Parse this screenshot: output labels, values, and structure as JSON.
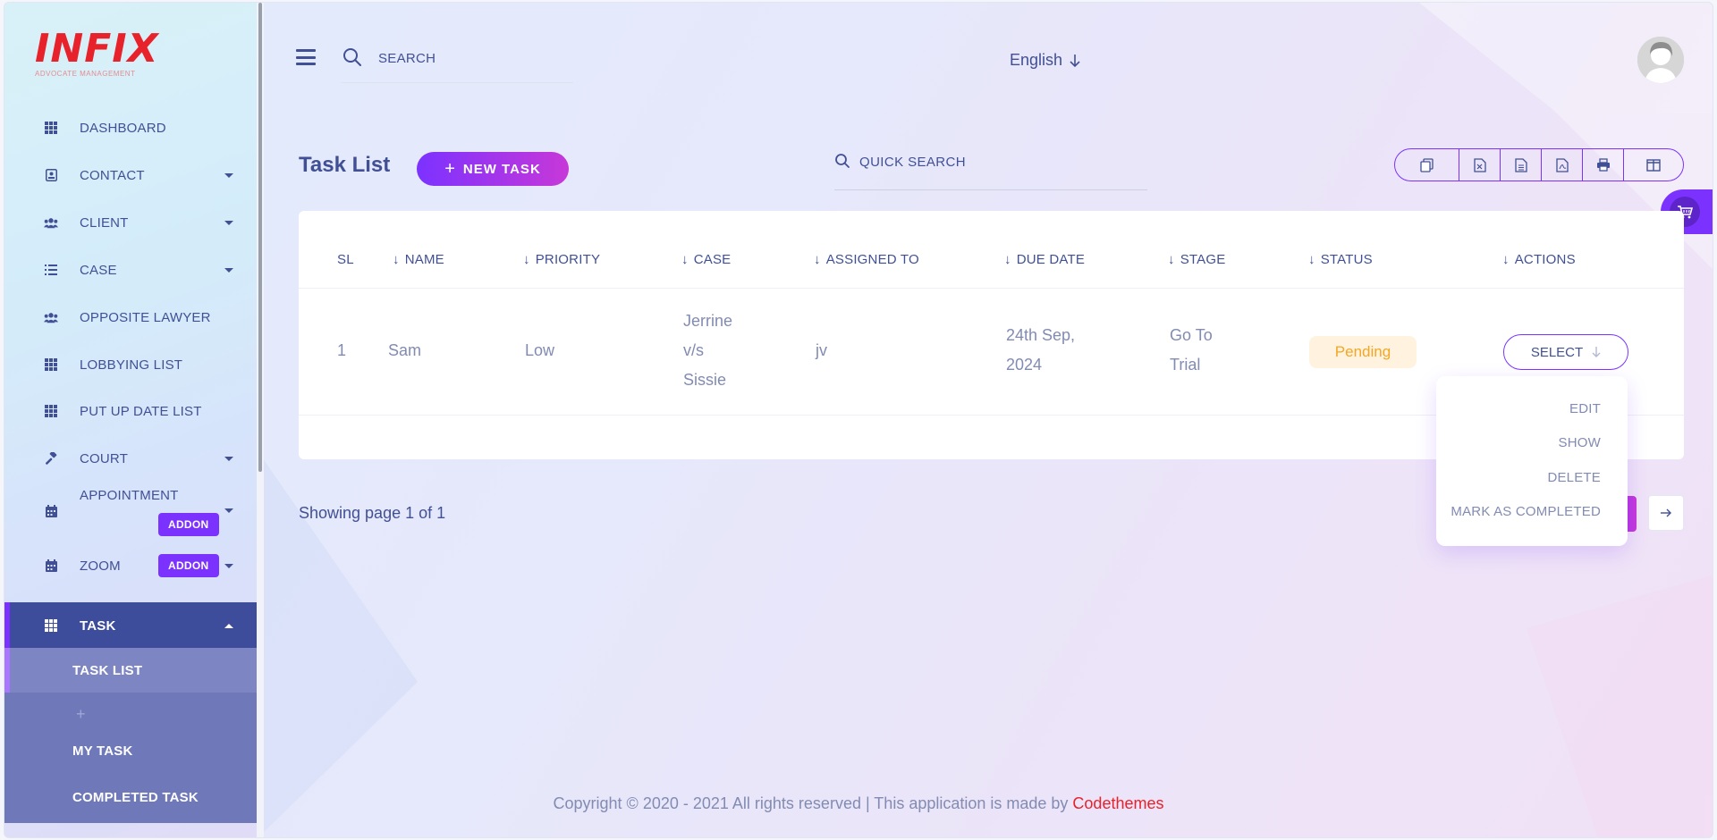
{
  "brand": {
    "logo": "INFIX",
    "tagline": "ADVOCATE MANAGEMENT"
  },
  "header": {
    "search_placeholder": "SEARCH",
    "language": "English"
  },
  "sidebar": {
    "items": [
      {
        "label": "DASHBOARD",
        "icon": "grid-icon"
      },
      {
        "label": "CONTACT",
        "icon": "contact-icon"
      },
      {
        "label": "CLIENT",
        "icon": "users-icon"
      },
      {
        "label": "CASE",
        "icon": "list-icon"
      },
      {
        "label": "OPPOSITE LAWYER",
        "icon": "users-icon"
      },
      {
        "label": "LOBBYING LIST",
        "icon": "grid-icon"
      },
      {
        "label": "PUT UP DATE LIST",
        "icon": "grid-icon"
      },
      {
        "label": "COURT",
        "icon": "gavel-icon"
      },
      {
        "label": "APPOINTMENT",
        "icon": "calendar-icon"
      },
      {
        "label": "ZOOM",
        "icon": "calendar-icon"
      },
      {
        "label": "TASK",
        "icon": "grid-icon"
      }
    ],
    "addon_label": "ADDON",
    "task_sub": [
      "TASK LIST",
      "MY TASK",
      "COMPLETED TASK"
    ]
  },
  "page": {
    "title": "Task List",
    "new_task": "NEW TASK",
    "quick_search": "QUICK SEARCH"
  },
  "table": {
    "columns": [
      "SL",
      "NAME",
      "PRIORITY",
      "CASE",
      "ASSIGNED TO",
      "DUE DATE",
      "STAGE",
      "STATUS",
      "ACTIONS"
    ],
    "rows": [
      {
        "sl": "1",
        "name": "Sam",
        "priority": "Low",
        "case": [
          "Jerrine",
          "v/s",
          "Sissie"
        ],
        "assigned_to": "jv",
        "due_date": [
          "24th Sep,",
          "2024"
        ],
        "stage": [
          "Go To",
          "Trial"
        ],
        "status": "Pending",
        "action": "SELECT"
      }
    ]
  },
  "dropdown": [
    "EDIT",
    "SHOW",
    "DELETE",
    "MARK AS COMPLETED"
  ],
  "pagination": {
    "showing": "Showing page 1 of 1"
  },
  "footer": {
    "text": "Copyright © 2020 - 2021 All rights reserved | This application is made by ",
    "brand": "Codethemes"
  },
  "colors": {
    "accent": "#7c32ff",
    "primary_text": "#415094",
    "brand_red": "#e8222a",
    "pending": "#f5a623"
  }
}
